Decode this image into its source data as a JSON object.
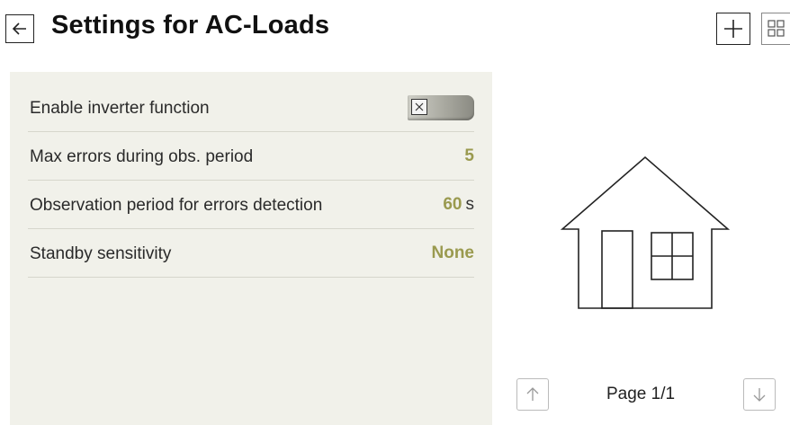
{
  "header": {
    "title": "Settings for AC-Loads",
    "back_icon": "arrow-left-icon",
    "add_icon": "plus-icon",
    "grid_icon": "grid-icon"
  },
  "settings": {
    "rows": [
      {
        "label": "Enable inverter function",
        "type": "toggle",
        "checked": false
      },
      {
        "label": "Max errors during obs. period",
        "value": "5",
        "unit": ""
      },
      {
        "label": "Observation period for errors detection",
        "value": "60",
        "unit": "s"
      },
      {
        "label": "Standby sensitivity",
        "value": "None",
        "unit": ""
      }
    ]
  },
  "preview": {
    "icon": "house-icon",
    "page_label": "Page 1/1",
    "up_icon": "arrow-up-icon",
    "down_icon": "arrow-down-icon"
  },
  "colors": {
    "value_accent": "#9a9a4f",
    "panel_background": "#f1f1ea"
  }
}
